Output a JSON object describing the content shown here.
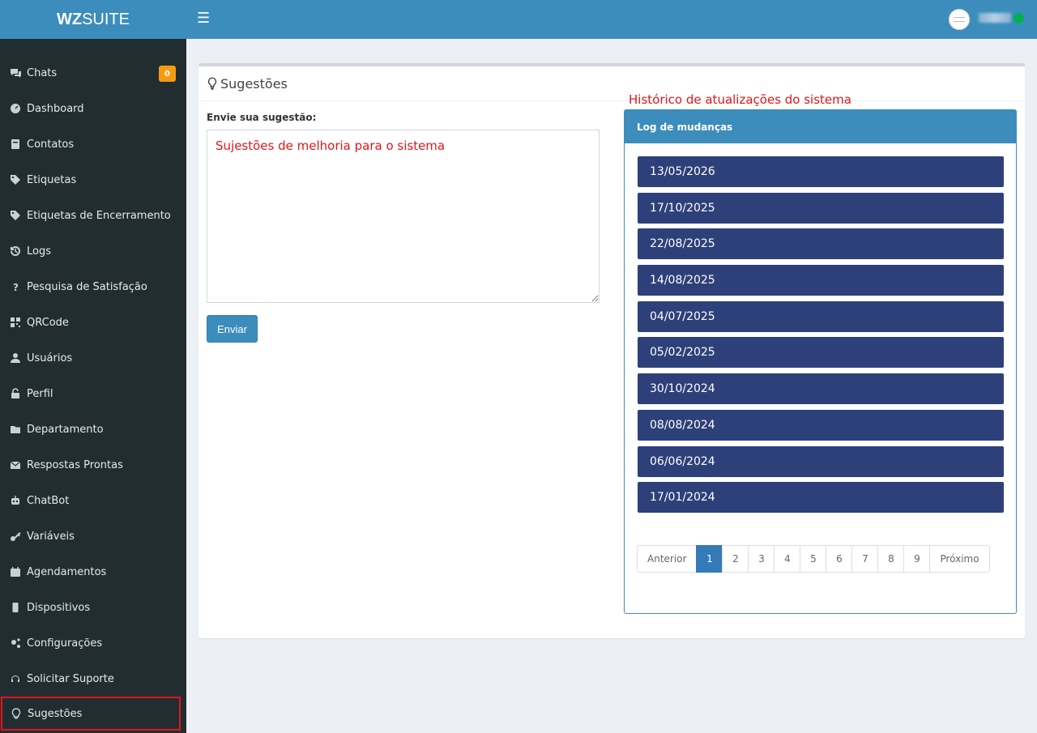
{
  "app": {
    "logo_bold": "WZ",
    "logo_rest": "SUITE"
  },
  "topbar": {
    "menu_icon": "hamburger-icon",
    "status_color": "#00b050"
  },
  "sidebar": {
    "items": [
      {
        "label": "Chats",
        "icon": "chats-icon",
        "badge": "0"
      },
      {
        "label": "Dashboard",
        "icon": "dashboard-icon"
      },
      {
        "label": "Contatos",
        "icon": "address-book-icon"
      },
      {
        "label": "Etiquetas",
        "icon": "tags-icon"
      },
      {
        "label": "Etiquetas de Encerramento",
        "icon": "tags-icon"
      },
      {
        "label": "Logs",
        "icon": "history-icon"
      },
      {
        "label": "Pesquisa de Satisfação",
        "icon": "question-icon"
      },
      {
        "label": "QRCode",
        "icon": "qrcode-icon"
      },
      {
        "label": "Usuários",
        "icon": "user-icon"
      },
      {
        "label": "Perfil",
        "icon": "unlock-icon"
      },
      {
        "label": "Departamento",
        "icon": "folder-icon"
      },
      {
        "label": "Respostas Prontas",
        "icon": "envelope-icon"
      },
      {
        "label": "ChatBot",
        "icon": "robot-icon"
      },
      {
        "label": "Variáveis",
        "icon": "key-icon"
      },
      {
        "label": "Agendamentos",
        "icon": "calendar-icon"
      },
      {
        "label": "Dispositivos",
        "icon": "mobile-icon"
      },
      {
        "label": "Configurações",
        "icon": "cogs-icon"
      },
      {
        "label": "Solicitar Suporte",
        "icon": "headset-icon"
      },
      {
        "label": "Sugestões",
        "icon": "lightbulb-icon",
        "active": true
      }
    ]
  },
  "page": {
    "title": "Sugestões",
    "form_label": "Envie sua sugestão:",
    "textarea_value": "Sujestões de melhoria para o sistema",
    "send_label": "Enviar",
    "history_title": "Histórico de atualizações do sistema",
    "log_header": "Log de mudanças",
    "log_dates": [
      "13/05/2026",
      "17/10/2025",
      "22/08/2025",
      "14/08/2025",
      "04/07/2025",
      "05/02/2025",
      "30/10/2024",
      "08/08/2024",
      "06/06/2024",
      "17/01/2024"
    ],
    "pagination": {
      "prev": "Anterior",
      "next": "Próximo",
      "pages": [
        "1",
        "2",
        "3",
        "4",
        "5",
        "6",
        "7",
        "8",
        "9"
      ],
      "current": "1"
    }
  },
  "colors": {
    "accent": "#3c8dbc",
    "sidebar_bg": "#222d32",
    "log_item_bg": "#2e4079",
    "highlight_red": "#e3151a",
    "badge": "#f39c12"
  }
}
